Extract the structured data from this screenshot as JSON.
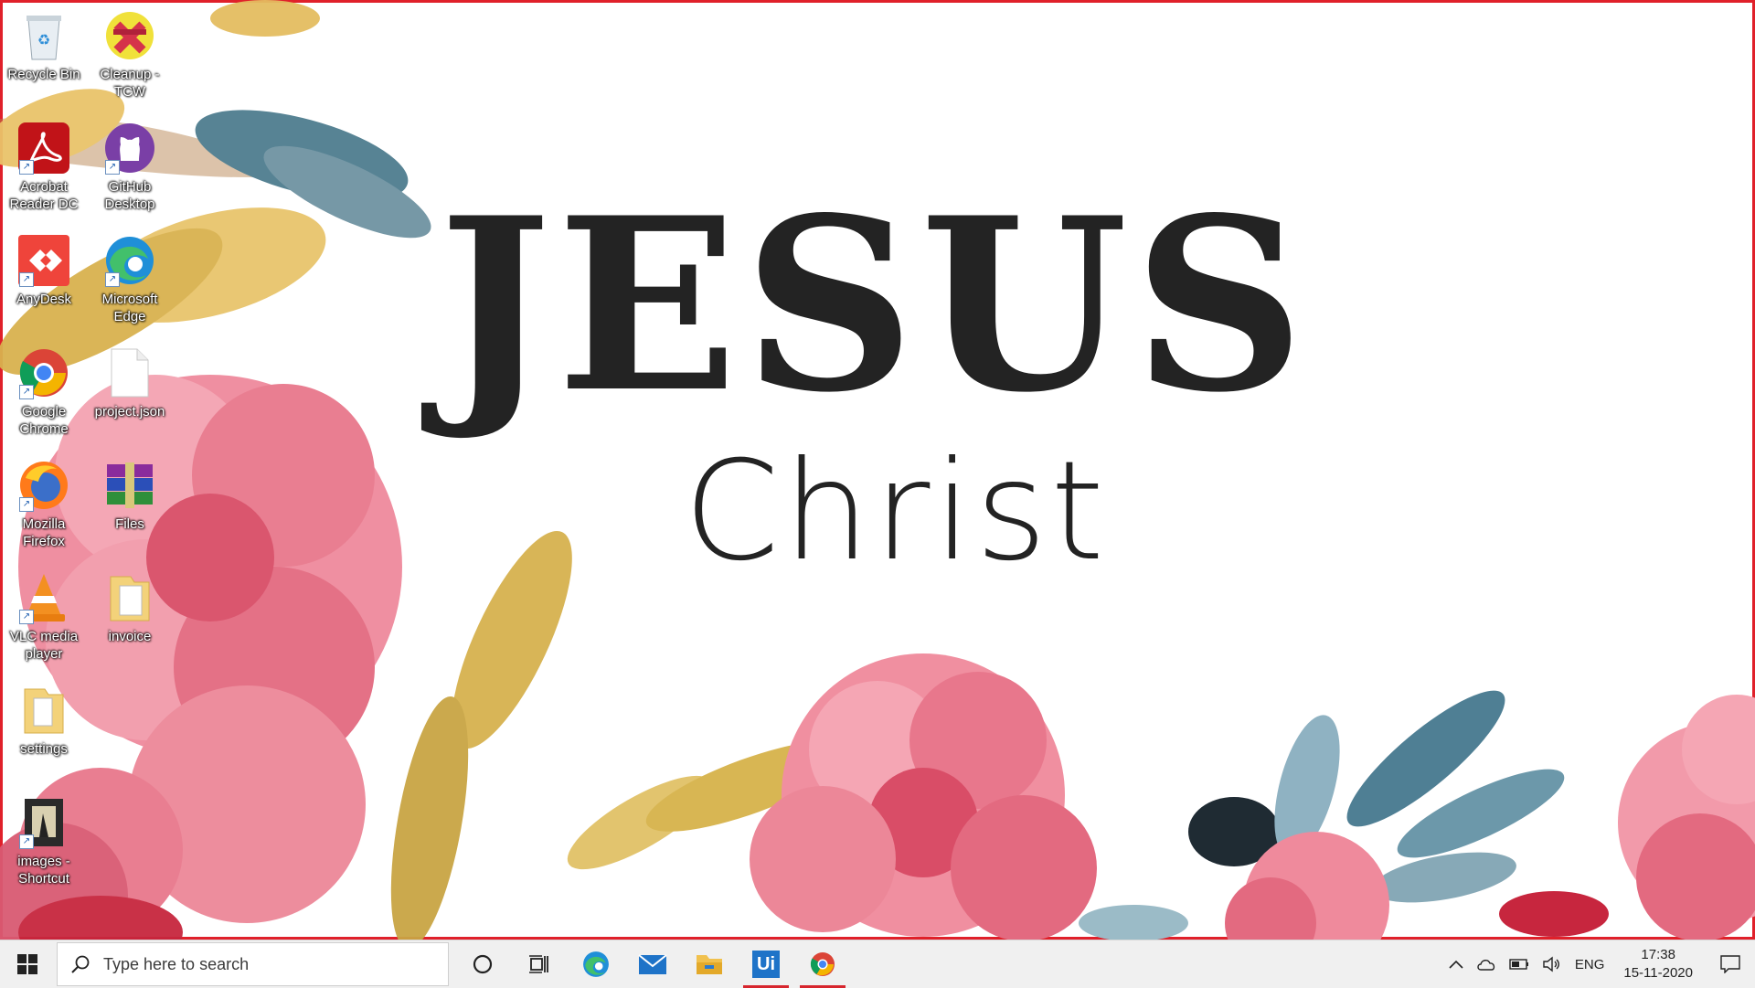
{
  "wallpaper": {
    "title": "JESUS",
    "subtitle": "Christ"
  },
  "desktop_icons": [
    {
      "label": "Recycle Bin",
      "icon": "recycle-bin-icon"
    },
    {
      "label": "Cleanup -\nTCW",
      "icon": "cleanup-icon"
    },
    {
      "label": "Acrobat\nReader DC",
      "icon": "acrobat-icon"
    },
    {
      "label": "GitHub\nDesktop",
      "icon": "github-icon"
    },
    {
      "label": "AnyDesk",
      "icon": "anydesk-icon"
    },
    {
      "label": "Microsoft\nEdge",
      "icon": "edge-icon"
    },
    {
      "label": "Google\nChrome",
      "icon": "chrome-icon"
    },
    {
      "label": "project.json",
      "icon": "file-icon"
    },
    {
      "label": "Mozilla\nFirefox",
      "icon": "firefox-icon"
    },
    {
      "label": "Files",
      "icon": "winrar-icon"
    },
    {
      "label": "VLC media\nplayer",
      "icon": "vlc-icon"
    },
    {
      "label": "invoice",
      "icon": "folder-icon"
    },
    {
      "label": "settings",
      "icon": "folder-icon"
    },
    {
      "label": "images -\nShortcut",
      "icon": "images-shortcut-icon"
    }
  ],
  "taskbar": {
    "search_placeholder": "Type here to search",
    "apps": [
      "cortana-icon",
      "task-view-icon",
      "edge-icon",
      "mail-icon",
      "file-explorer-icon",
      "uipath-icon",
      "chrome-icon"
    ],
    "uipath_label": "Ui",
    "tray": {
      "language": "ENG",
      "time": "17:38",
      "date": "15-11-2020"
    }
  },
  "colors": {
    "accent_red": "#d7262e",
    "taskbar_bg": "#f0f0f0",
    "wallpaper_text": "#232323"
  }
}
